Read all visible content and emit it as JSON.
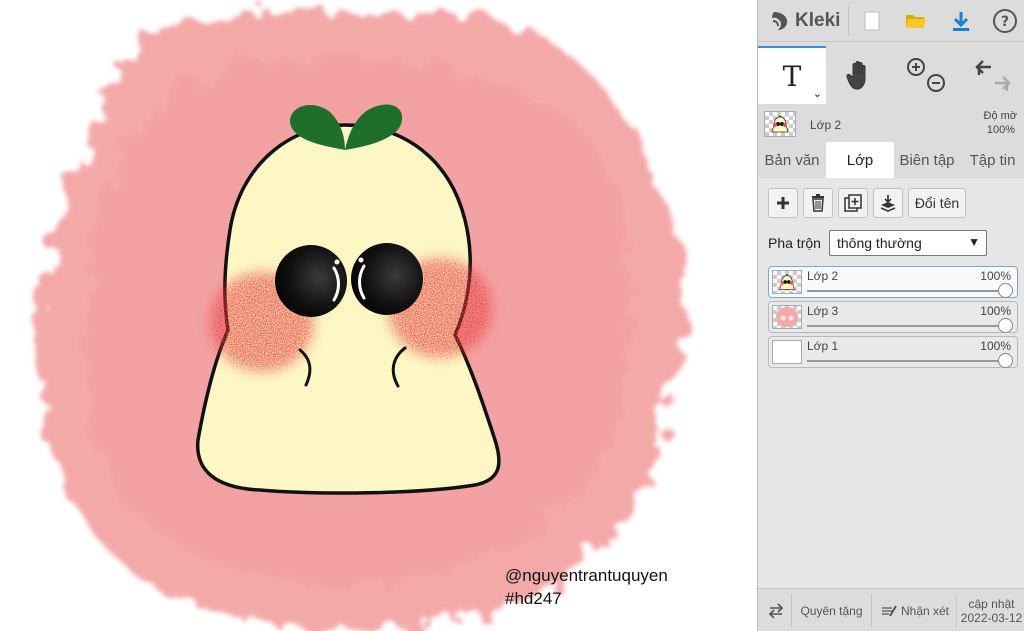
{
  "canvas": {
    "watermark_handle": "@nguyentrantuquyen",
    "watermark_tag": "#hđ247"
  },
  "topbar": {
    "logo_text": "Kleki",
    "icons": [
      "kleki-logo-icon",
      "new-file-icon",
      "open-folder-icon",
      "download-icon",
      "help-icon"
    ]
  },
  "tools": {
    "text_tool_glyph": "T",
    "caret": "⌄"
  },
  "layer_info": {
    "name": "Lớp 2",
    "opacity_label": "Độ mờ",
    "opacity_value": "100%"
  },
  "tabs": [
    {
      "label": "Bản văn",
      "active": false
    },
    {
      "label": "Lớp",
      "active": true
    },
    {
      "label": "Biên tập",
      "active": false
    },
    {
      "label": "Tập tin",
      "active": false
    }
  ],
  "layer_panel": {
    "rename_label": "Đổi tên",
    "blend_label": "Pha trộn",
    "blend_value": "thông thường",
    "layers": [
      {
        "name": "Lớp 2",
        "opacity": "100%",
        "selected": true
      },
      {
        "name": "Lớp 3",
        "opacity": "100%",
        "selected": false
      },
      {
        "name": "Lớp 1",
        "opacity": "100%",
        "selected": false
      }
    ]
  },
  "bottombar": {
    "donate_label": "Quyên tặng",
    "feedback_label": "Nhận xét",
    "update_label": "cập nhật",
    "update_date": "2022-03-12"
  },
  "colors": {
    "accent": "#3a8fd8",
    "panel_bg": "#dcdcdc",
    "splash_pink": "#f4a6a6",
    "body_cream": "#fcf6c6",
    "leaf_green": "#1e6e2a",
    "blush_red": "#f05050"
  }
}
